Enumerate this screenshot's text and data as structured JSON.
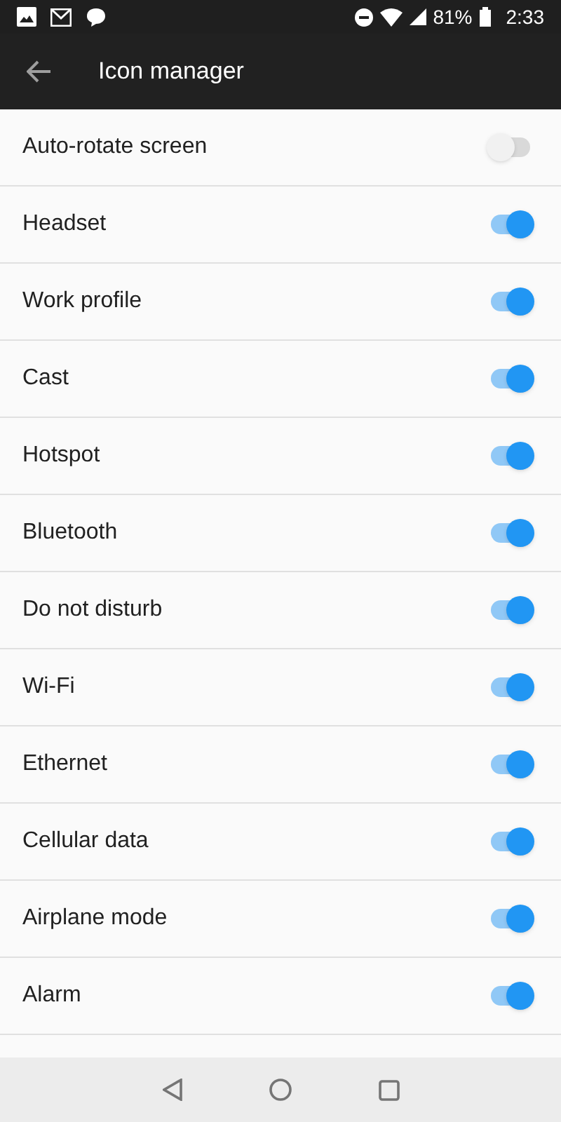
{
  "status_bar": {
    "battery": "81%",
    "time": "2:33"
  },
  "app_bar": {
    "title": "Icon manager"
  },
  "items": [
    {
      "label": "Auto-rotate screen",
      "on": false
    },
    {
      "label": "Headset",
      "on": true
    },
    {
      "label": "Work profile",
      "on": true
    },
    {
      "label": "Cast",
      "on": true
    },
    {
      "label": "Hotspot",
      "on": true
    },
    {
      "label": "Bluetooth",
      "on": true
    },
    {
      "label": "Do not disturb",
      "on": true
    },
    {
      "label": "Wi-Fi",
      "on": true
    },
    {
      "label": "Ethernet",
      "on": true
    },
    {
      "label": "Cellular data",
      "on": true
    },
    {
      "label": "Airplane mode",
      "on": true
    },
    {
      "label": "Alarm",
      "on": true
    }
  ]
}
